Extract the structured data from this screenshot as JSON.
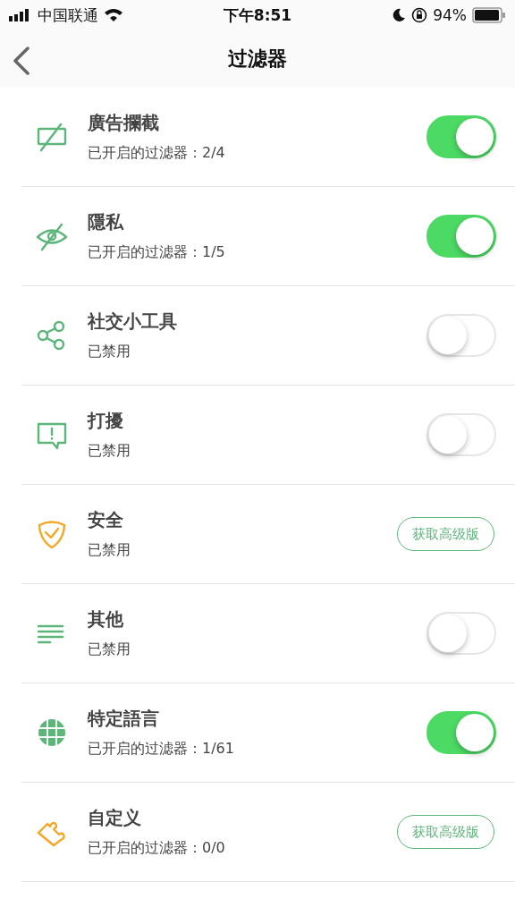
{
  "status_bar": {
    "carrier": "中国联通",
    "time": "下午8:51",
    "battery_text": "94%"
  },
  "nav": {
    "title": "过滤器"
  },
  "filters": [
    {
      "color": "#5cb67a",
      "title": "廣告攔截",
      "subtitle": "已开启的过滤器：2/4",
      "kind": "toggle",
      "on": true
    },
    {
      "color": "#5cb67a",
      "title": "隱私",
      "subtitle": "已开启的过滤器：1/5",
      "kind": "toggle",
      "on": true
    },
    {
      "color": "#5cb67a",
      "title": "社交小工具",
      "subtitle": "已禁用",
      "kind": "toggle",
      "on": false
    },
    {
      "color": "#5cb67a",
      "title": "打擾",
      "subtitle": "已禁用",
      "kind": "toggle",
      "on": false
    },
    {
      "color": "#f5a623",
      "title": "安全",
      "subtitle": "已禁用",
      "kind": "premium",
      "button": "获取高级版"
    },
    {
      "color": "#5cb67a",
      "title": "其他",
      "subtitle": "已禁用",
      "kind": "toggle",
      "on": false
    },
    {
      "color": "#5cb67a",
      "title": "特定語言",
      "subtitle": "已开启的过滤器：1/61",
      "kind": "toggle",
      "on": true
    },
    {
      "color": "#f5a623",
      "title": "自定义",
      "subtitle": "已开启的过滤器：0/0",
      "kind": "premium",
      "button": "获取高级版"
    }
  ]
}
